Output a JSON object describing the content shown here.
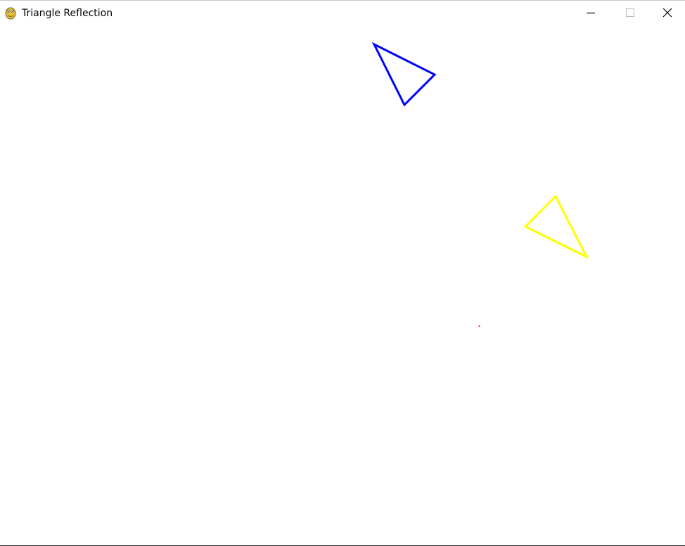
{
  "window": {
    "title": "Triangle Reflection"
  },
  "titlebar": {
    "app_icon": "pygame-snake-icon",
    "buttons": [
      {
        "name": "minimize",
        "icon": "minimize-icon"
      },
      {
        "name": "maximize",
        "icon": "maximize-icon"
      },
      {
        "name": "close",
        "icon": "close-icon"
      }
    ]
  },
  "scene": {
    "original_triangle": {
      "color": "#0000ff"
    },
    "reflected_triangle": {
      "color": "#ffff00"
    },
    "center_point": {
      "color": "#ff0000"
    }
  }
}
